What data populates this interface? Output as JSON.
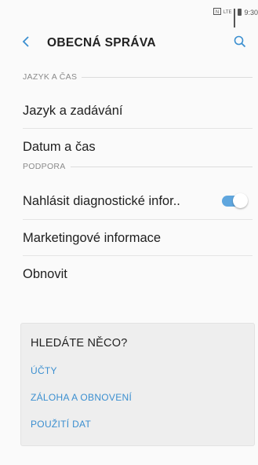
{
  "status_bar": {
    "time": "9:30",
    "network_label": "LTE",
    "icons": [
      "nfc-icon",
      "lte-icon",
      "signal-icon",
      "battery-icon"
    ]
  },
  "header": {
    "title": "OBECNÁ SPRÁVA",
    "back_icon": "chevron-left-icon",
    "search_icon": "search-icon"
  },
  "sections": {
    "language": {
      "header": "JAZYK A ČAS",
      "items": [
        {
          "label": "Jazyk a zadávání"
        },
        {
          "label": "Datum a čas"
        }
      ]
    },
    "support": {
      "header": "PODPORA",
      "items": [
        {
          "label": "Nahlásit diagnostické infor..",
          "toggle_on": true
        },
        {
          "label": "Marketingové informace"
        },
        {
          "label": "Obnovit"
        }
      ]
    }
  },
  "card": {
    "title": "HLEDÁTE NĚCO?",
    "links": [
      {
        "label": "ÚČTY"
      },
      {
        "label": "ZÁLOHA A OBNOVENÍ"
      },
      {
        "label": "POUŽITÍ DAT"
      }
    ]
  },
  "colors": {
    "accent": "#3b8fd0",
    "toggle_on": "#5fa6de",
    "background": "#fafafa",
    "card_background": "#eeeeee"
  }
}
